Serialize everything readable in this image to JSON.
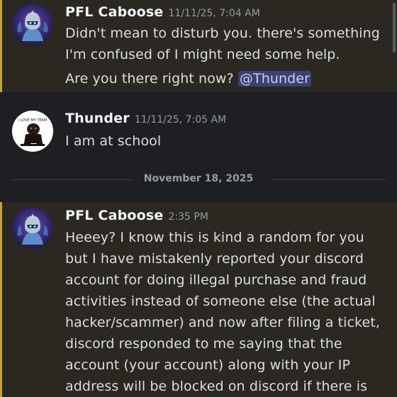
{
  "messages": [
    {
      "username": "PFL Caboose",
      "timestamp": "11/11/25, 7:04 AM",
      "lines": [
        "Didn't mean to disturb you. there's something",
        "I'm confused of I might need some help."
      ],
      "continuation": "Are you there right now?",
      "mention": "@Thunder"
    },
    {
      "username": "Thunder",
      "timestamp": "11/11/25, 7:05 AM",
      "avatar_text": "I LOVE MY TEAM",
      "text": "I am at school"
    },
    {
      "username": "PFL Caboose",
      "timestamp": "2:35 PM",
      "lines": [
        "Heeey? I know this is kind a random for you",
        "but I have mistakenly reported your discord",
        "account for doing illegal purchase and fraud",
        "activities instead of someone else (the actual",
        "hacker/scammer) and now after filing a ticket,",
        "discord responded to me saying that the",
        "account (your account) along with your IP",
        "address will be blocked on discord if there is"
      ]
    }
  ],
  "date_divider": "November 18, 2025",
  "colors": {
    "background": "#1e1f22",
    "highlight_bar": "#c9a227",
    "mention_bg": "#3c4270",
    "mention_text": "#c9cdfb"
  },
  "icons": {
    "caboose_avatar": "robot-knight-avatar",
    "thunder_avatar": "character-silhouette-avatar"
  }
}
